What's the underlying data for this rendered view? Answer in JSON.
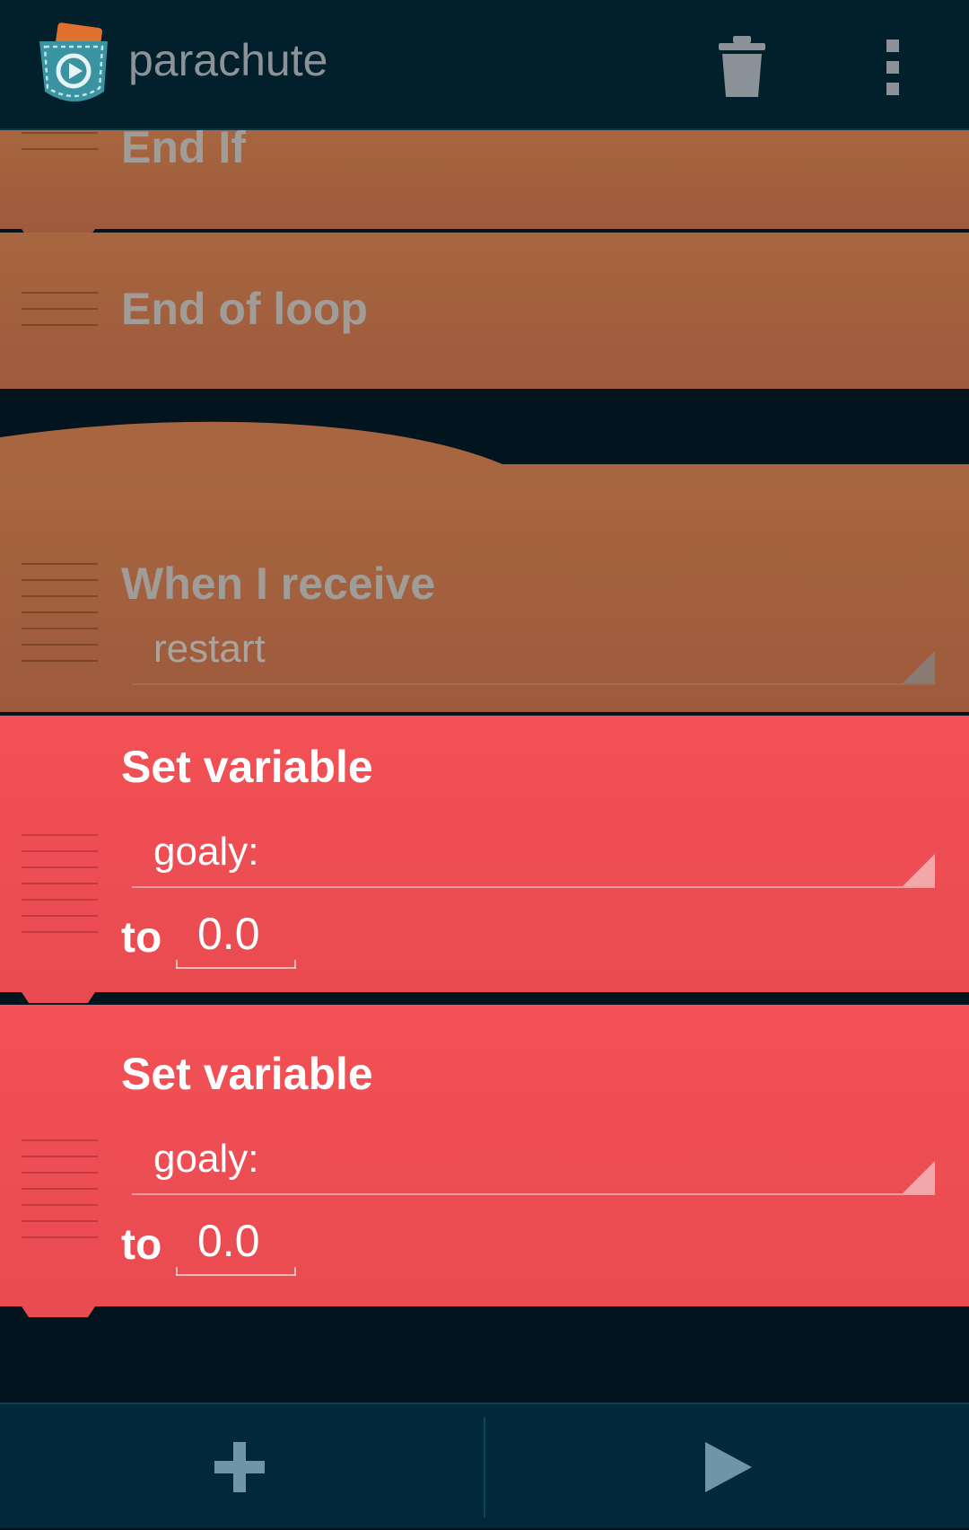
{
  "app": {
    "title": "parachute"
  },
  "toolbar": {
    "delete_icon": "trash-icon",
    "overflow_icon": "more-vert-icon"
  },
  "bricks": [
    {
      "type": "control",
      "color": "#a3613e",
      "title": "End If"
    },
    {
      "type": "control",
      "color": "#a3613e",
      "title": "End of loop"
    },
    {
      "type": "event",
      "color": "#a3613e",
      "title": "When I receive",
      "message": "restart"
    },
    {
      "type": "data",
      "color": "#f04f54",
      "title": "Set variable",
      "variable": "goaly:",
      "to_label": "to",
      "value": "0.0"
    },
    {
      "type": "data",
      "color": "#f04f54",
      "title": "Set variable",
      "variable": "goaly:",
      "to_label": "to",
      "value": "0.0"
    }
  ],
  "bottom_bar": {
    "add_icon": "plus-icon",
    "play_icon": "play-icon"
  }
}
